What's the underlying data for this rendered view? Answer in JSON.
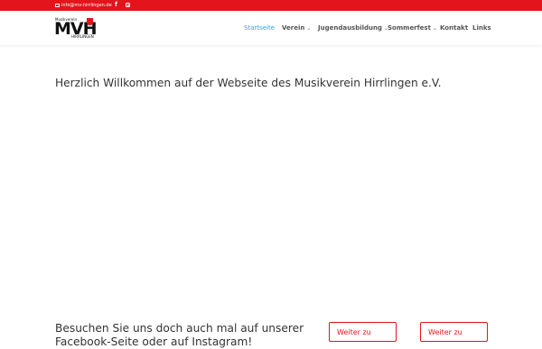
{
  "topbar": {
    "email": "info@mv-hirrlingen.de",
    "icons": [
      "envelope-icon",
      "facebook-icon",
      "instagram-icon"
    ],
    "bg_color": "#e3141b"
  },
  "logo": {
    "mark": "MVH",
    "top_text": "Musikverein",
    "bottom_text": "HIRRLINGEN"
  },
  "nav": {
    "items": [
      {
        "label": "Startseite",
        "active": true
      },
      {
        "label": "Verein",
        "dropdown": true
      },
      {
        "label": "Jugendausbildung",
        "dropdown": true
      },
      {
        "label": "Sommerfest",
        "dropdown": true
      },
      {
        "label": "Kontakt"
      },
      {
        "label": "Links"
      }
    ],
    "chevron": "⌄",
    "active_color": "#2ea3f2"
  },
  "main": {
    "welcome": "Herzlich Willkommen auf der Webseite des Musikverein Hirrlingen e.V.",
    "visit_text": "Besuchen Sie uns doch auch mal auf unserer Facebook-Seite oder auf Instagram!",
    "buttons": [
      "Weiter zu",
      "Weiter zu"
    ],
    "accent_color": "#e3141b"
  }
}
